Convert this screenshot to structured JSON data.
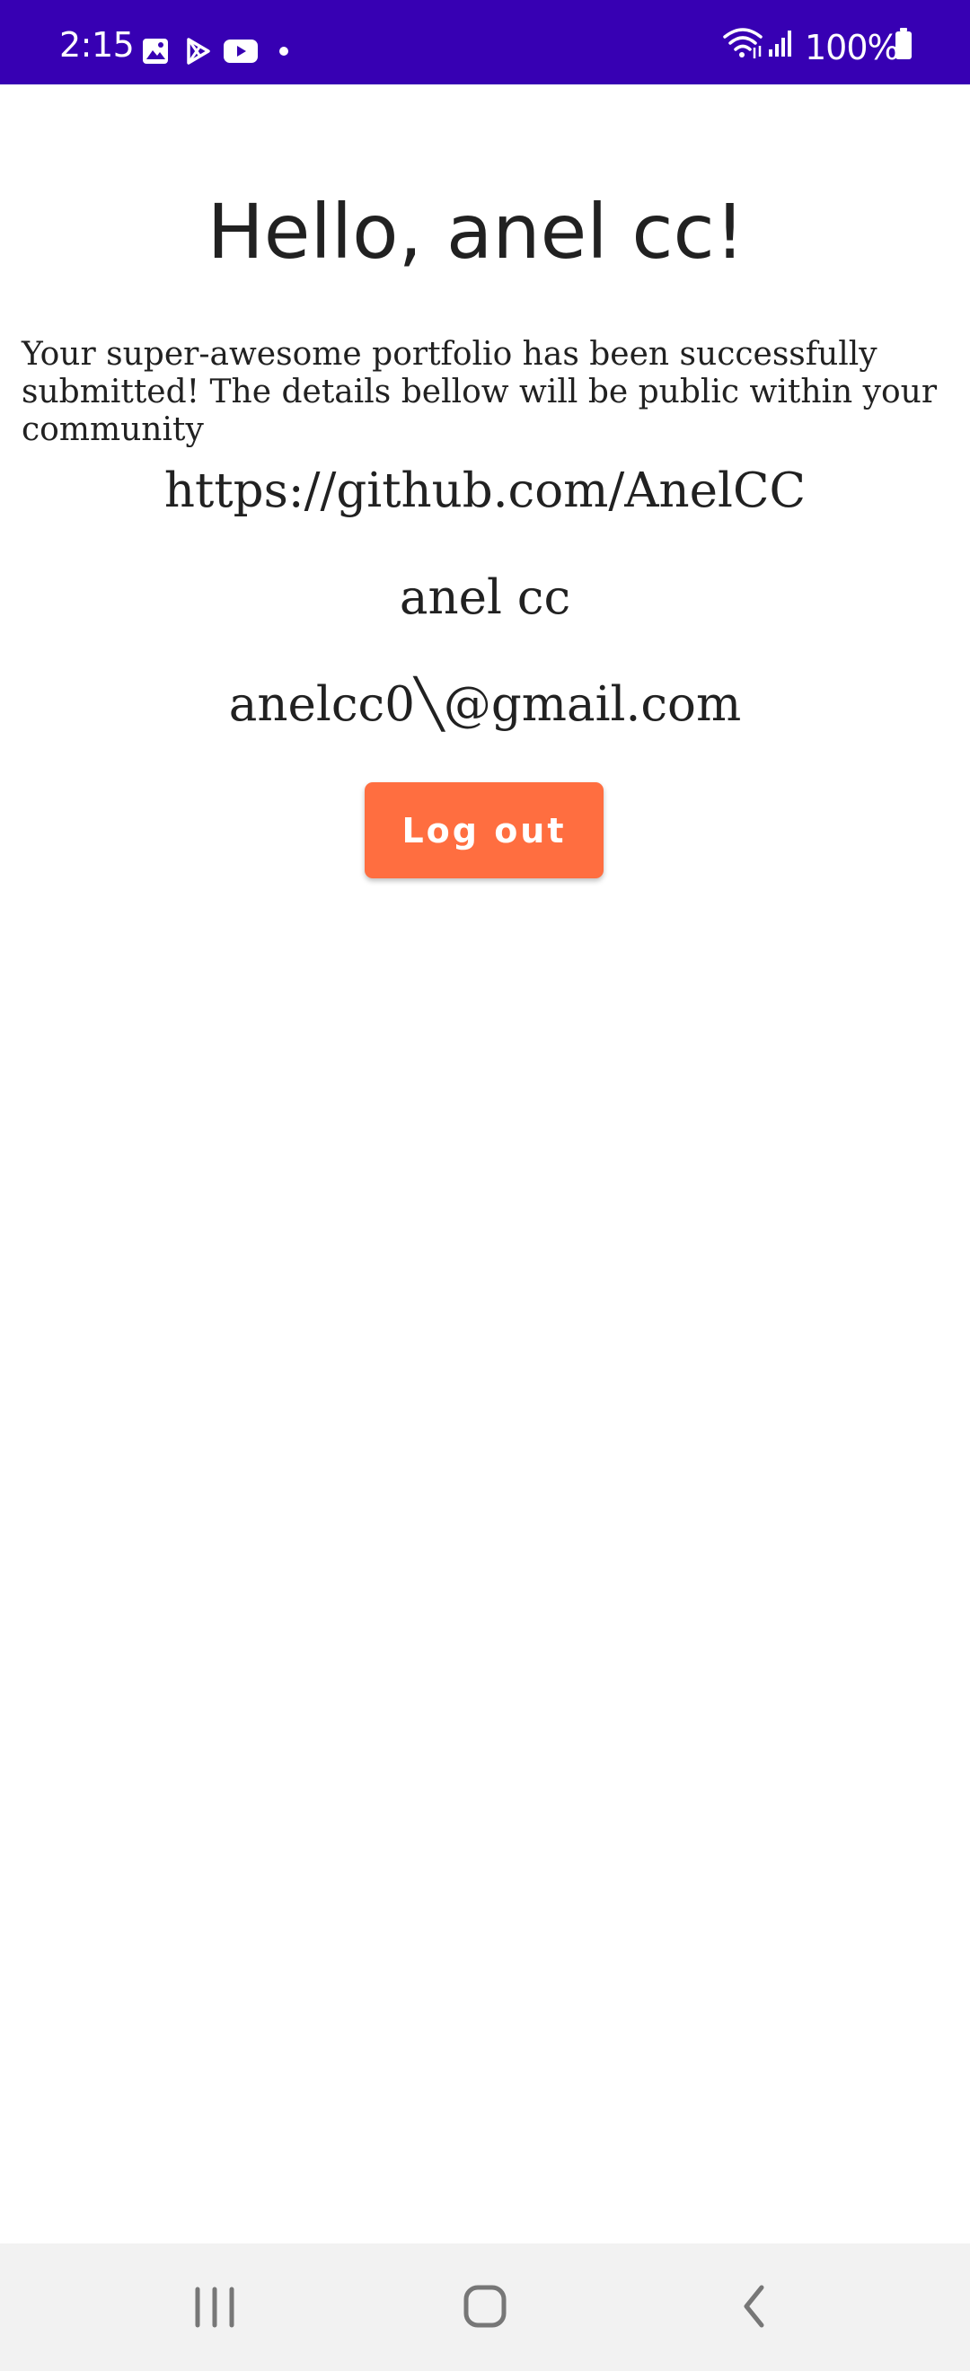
{
  "status_bar": {
    "time": "2:15",
    "battery": "100%",
    "background_color": "#3700b3",
    "left_icons": [
      "gallery-icon",
      "play-store-icon",
      "youtube-icon",
      "notification-dot-icon"
    ],
    "right_icons": [
      "wifi-icon",
      "signal-icon",
      "battery-icon"
    ]
  },
  "content": {
    "greeting": "Hello, anel cc!",
    "message": "Your super-awesome portfolio has been successfully submitted! The details bellow will be public within your community",
    "github_url": "https://github.com/AnelCC",
    "name": "anel cc",
    "email": "anelcc0╲@gmail.com"
  },
  "actions": {
    "logout_label": "Log out",
    "logout_color": "#ff6e40"
  },
  "nav_bar": {
    "buttons": [
      "recents-icon",
      "home-icon",
      "back-icon"
    ]
  }
}
